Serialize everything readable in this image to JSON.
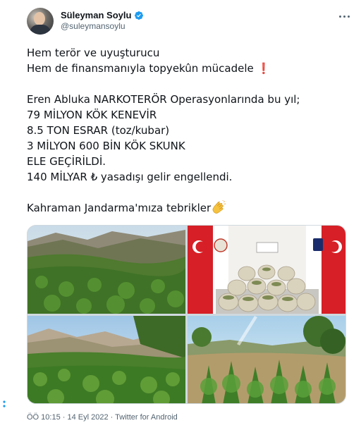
{
  "user": {
    "display_name": "Süleyman Soylu",
    "handle": "@suleymansoylu",
    "avatar_icon": "profile-photo",
    "verified_icon": "verified-badge-icon"
  },
  "tweet": {
    "lines": [
      "Hem terör ve uyuşturucu",
      "Hem de finansmanıyla topyekûn mücadele",
      "Eren Abluka NARKOTERÖR Operasyonlarında bu yıl;",
      "79 MİLYON KÖK KENEVİR",
      "8.5 TON ESRAR (toz/kubar)",
      "3 MİLYON 600 BİN KÖK SKUNK",
      "ELE GEÇİRİLDİ.",
      "140 MİLYAR ₺ yasadışı gelir engellendi.",
      "Kahraman Jandarma'mıza tebrikler"
    ],
    "exclamation_emoji": "❗",
    "clap_emoji_icon": "clapping-hands-icon"
  },
  "media": {
    "photos": [
      "cannabis-field-mountain",
      "seized-sacks-display",
      "cannabis-field-valley",
      "cannabis-field-sunlight"
    ]
  },
  "footer": {
    "meta": "ÖÖ 10:15 · 14 Eyl 2022 · Twitter for Android"
  },
  "colors": {
    "text": "#0f1419",
    "secondary": "#536471",
    "verified": "#1d9bf0",
    "border": "#cfd9de"
  }
}
